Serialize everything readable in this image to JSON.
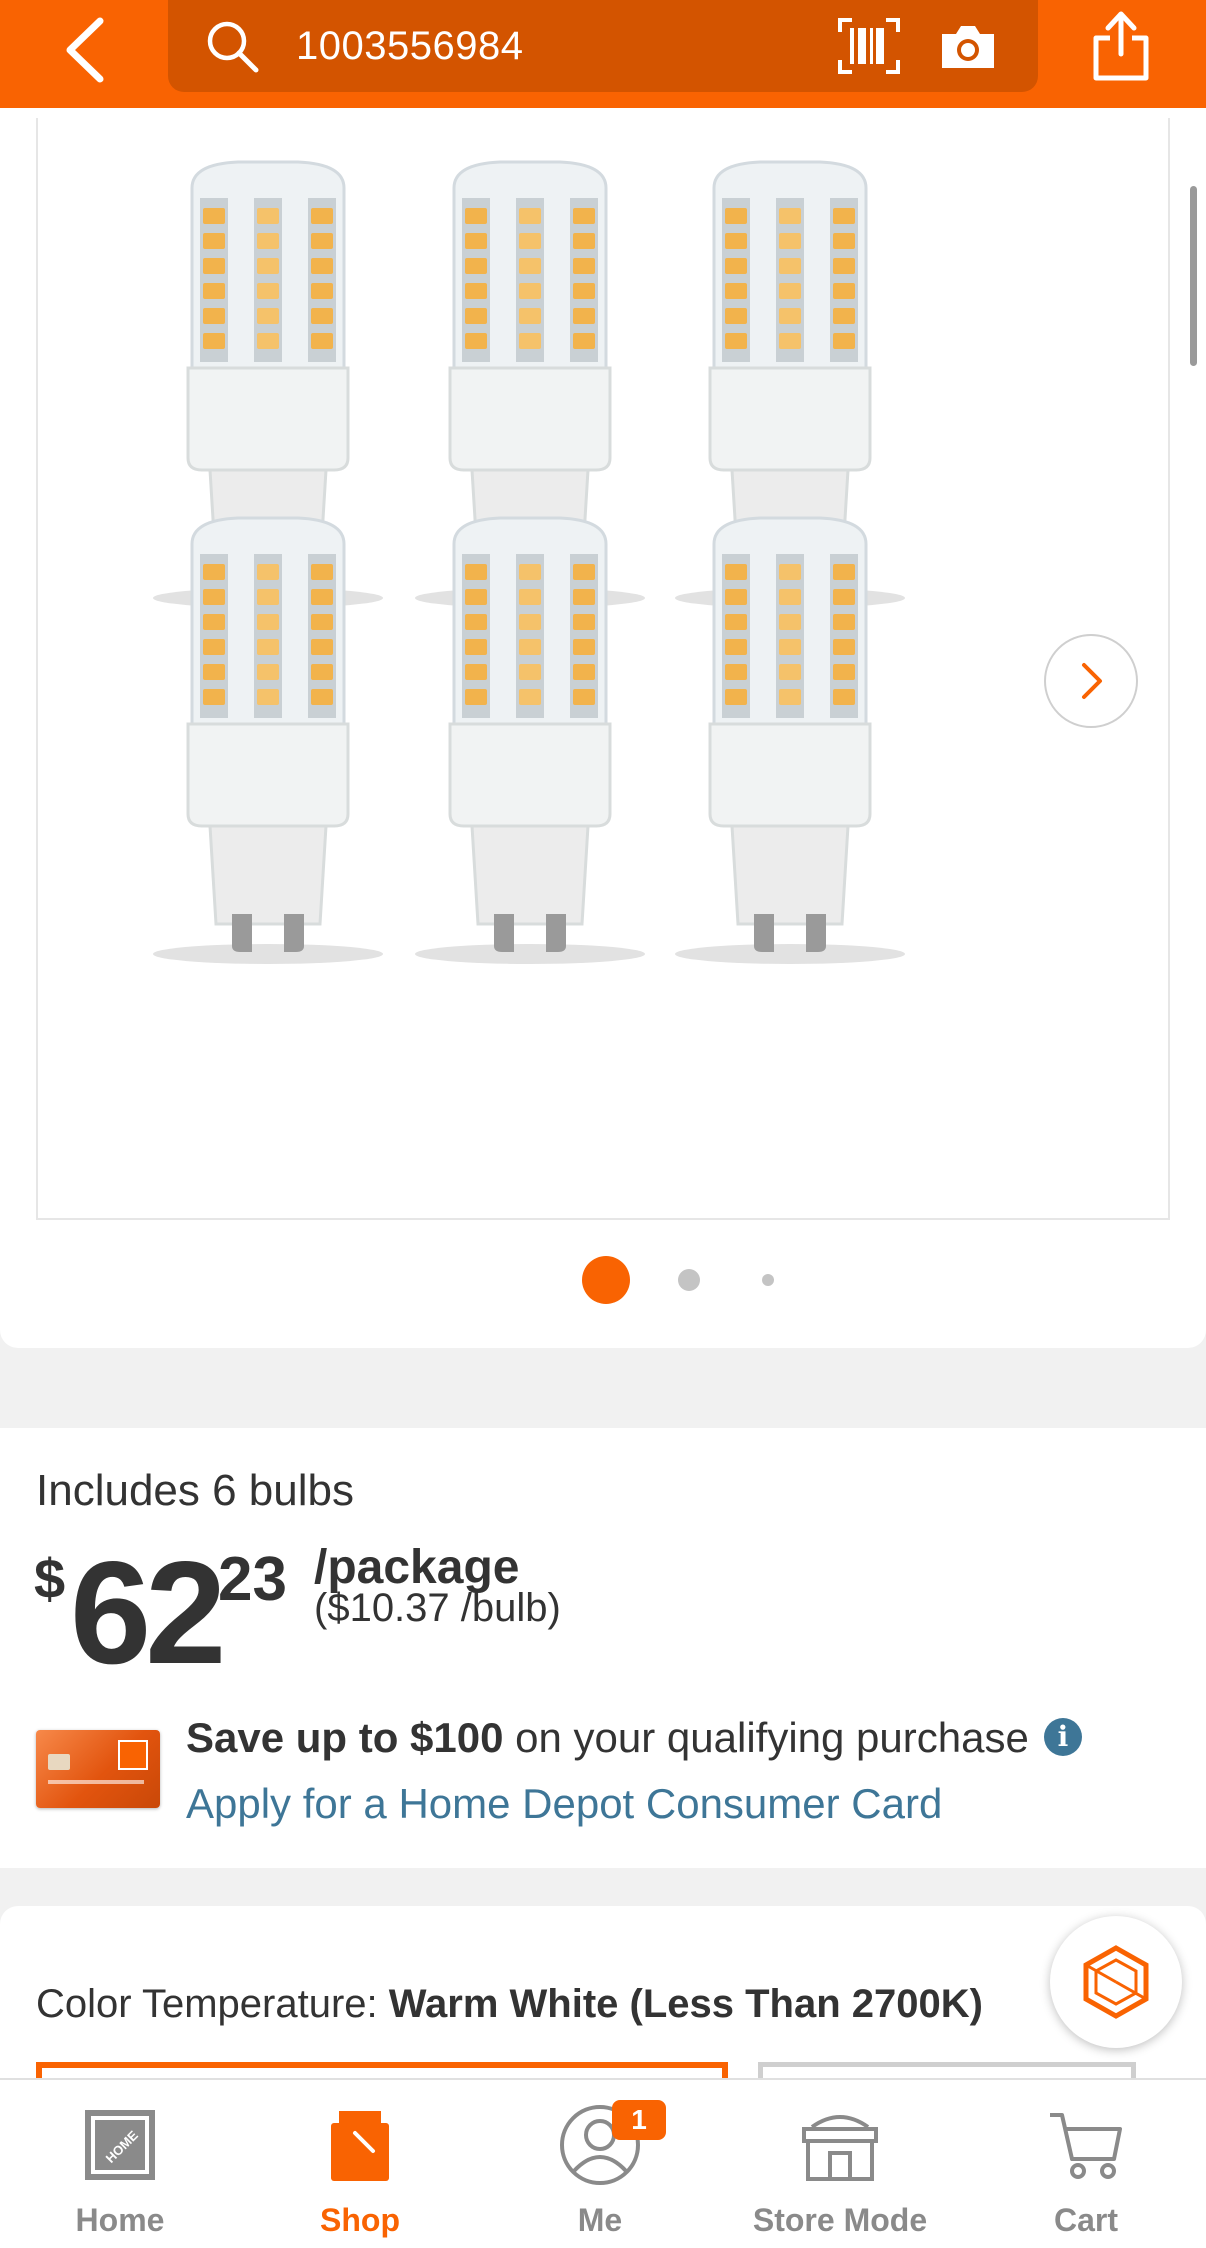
{
  "header": {
    "search_value": "1003556984"
  },
  "product": {
    "image_dots": 3,
    "active_image_index": 0,
    "includes_text": "Includes 6 bulbs",
    "currency_symbol": "$",
    "price_whole": "62",
    "price_cents": "23",
    "price_unit": "/package",
    "price_per_bulb": "($10.37 /bulb)"
  },
  "promo": {
    "save_bold": "Save up to $100",
    "save_rest": " on your qualifying purchase",
    "apply_link": "Apply for a Home Depot Consumer Card"
  },
  "color_temperature": {
    "label": "Color Temperature: ",
    "value": "Warm White (Less Than 2700K)"
  },
  "bottom_nav": {
    "items": [
      {
        "label": "Home",
        "icon": "home-depot-logo-icon",
        "active": false
      },
      {
        "label": "Shop",
        "icon": "shop-icon",
        "active": true
      },
      {
        "label": "Me",
        "icon": "user-icon",
        "active": false,
        "badge": "1"
      },
      {
        "label": "Store Mode",
        "icon": "store-icon",
        "active": false
      },
      {
        "label": "Cart",
        "icon": "cart-icon",
        "active": false
      }
    ]
  },
  "colors": {
    "brand_orange": "#f96302",
    "search_bg": "#d35400",
    "link_blue": "#3e7697",
    "text": "#333333"
  }
}
